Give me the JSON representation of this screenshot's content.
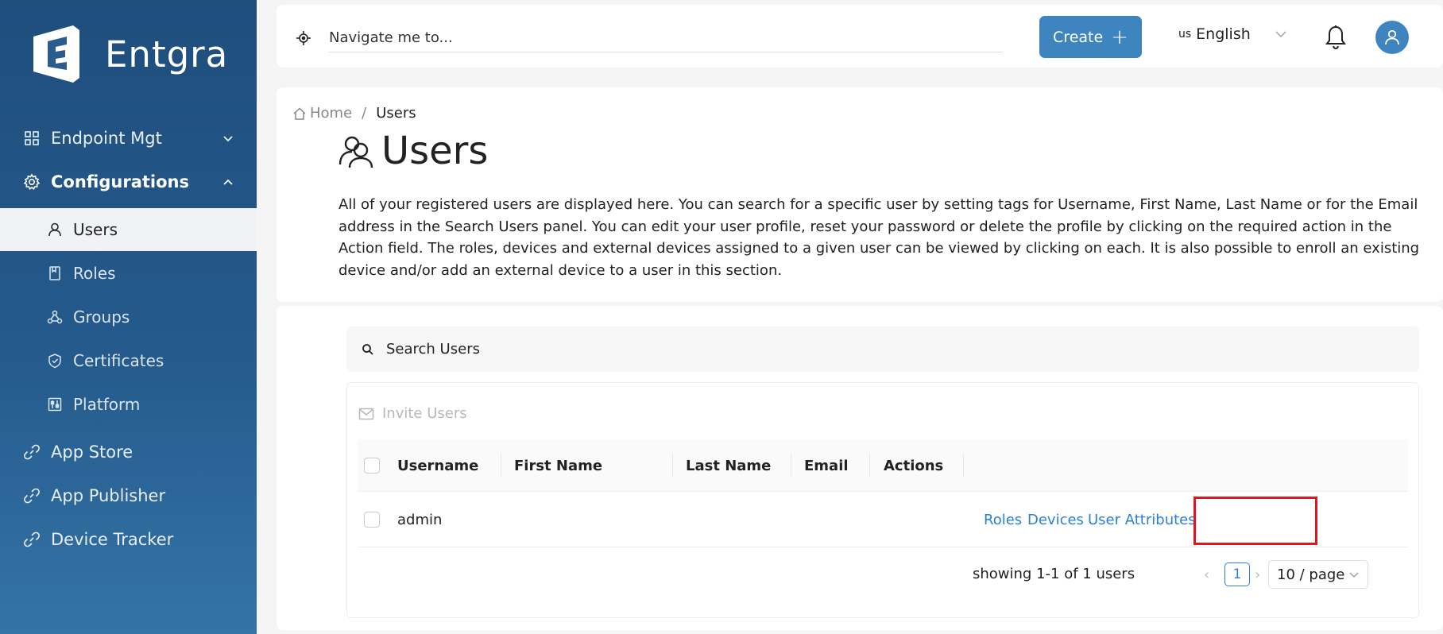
{
  "brand": {
    "name": "Entgra"
  },
  "sidebar": {
    "items": [
      {
        "label": "Endpoint Mgt",
        "icon": "grid-icon"
      },
      {
        "label": "Configurations",
        "icon": "gear-icon"
      },
      {
        "label": "App Store",
        "icon": "link-icon"
      },
      {
        "label": "App Publisher",
        "icon": "link-icon"
      },
      {
        "label": "Device Tracker",
        "icon": "link-icon"
      }
    ],
    "sub_items": [
      {
        "label": "Users",
        "icon": "user-icon",
        "active": true
      },
      {
        "label": "Roles",
        "icon": "bookmark-icon"
      },
      {
        "label": "Groups",
        "icon": "groups-icon"
      },
      {
        "label": "Certificates",
        "icon": "shield-icon"
      },
      {
        "label": "Platform",
        "icon": "sliders-icon"
      }
    ]
  },
  "header": {
    "nav_placeholder": "Navigate me to...",
    "create_label": "Create",
    "lang_code": "us",
    "lang_label": "English"
  },
  "breadcrumb": {
    "home": "Home",
    "current": "Users"
  },
  "page": {
    "title": "Users",
    "description": "All of your registered users are displayed here. You can search for a specific user by setting tags for Username, First Name, Last Name or for the Email address in the Search Users panel. You can edit your user profile, reset your password or delete the profile by clicking on the required action in the Action field. The roles, devices and external devices assigned to a given user can be viewed by clicking on each. It is also possible to enroll an existing device and/or add an external device to a user in this section."
  },
  "search": {
    "placeholder": "Search Users"
  },
  "invite_label": "Invite Users",
  "table": {
    "columns": [
      "Username",
      "First Name",
      "Last Name",
      "Email",
      "Actions"
    ],
    "rows": [
      {
        "username": "admin",
        "first_name": "",
        "last_name": "",
        "email": "",
        "actions": [
          "Roles",
          "Devices",
          "User Attributes"
        ]
      }
    ]
  },
  "pagination": {
    "summary": "showing 1-1 of 1 users",
    "current_page": "1",
    "page_size": "10 / page"
  },
  "colors": {
    "sidebar_top": "#1f4e7d",
    "accent": "#3e85c0",
    "link": "#2b7fd3",
    "highlight": "#e0161e"
  }
}
